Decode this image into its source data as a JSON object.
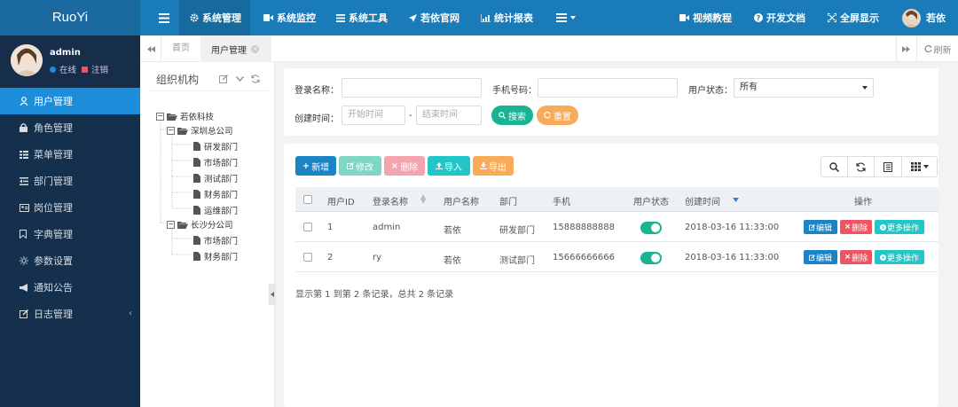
{
  "app": {
    "brand": "RuoYi"
  },
  "topnav": {
    "items": [
      {
        "label": "系统管理",
        "icon": "gear-icon"
      },
      {
        "label": "系统监控",
        "icon": "video-icon"
      },
      {
        "label": "系统工具",
        "icon": "list-icon"
      },
      {
        "label": "若依官网",
        "icon": "send-icon"
      },
      {
        "label": "统计报表",
        "icon": "chart-icon"
      }
    ],
    "right": [
      {
        "label": "视频教程",
        "icon": "video-icon"
      },
      {
        "label": "开发文档",
        "icon": "question-icon"
      },
      {
        "label": "全屏显示",
        "icon": "fullscreen-icon"
      }
    ],
    "user": "若依"
  },
  "profile": {
    "name": "admin",
    "online": "在线",
    "logout": "注销"
  },
  "sidebar": {
    "items": [
      {
        "label": "用户管理",
        "active": true
      },
      {
        "label": "角色管理"
      },
      {
        "label": "菜单管理"
      },
      {
        "label": "部门管理"
      },
      {
        "label": "岗位管理"
      },
      {
        "label": "字典管理"
      },
      {
        "label": "参数设置"
      },
      {
        "label": "通知公告"
      },
      {
        "label": "日志管理"
      }
    ]
  },
  "tabs": {
    "home": "首页",
    "current": "用户管理",
    "refresh": "刷新"
  },
  "org": {
    "title": "组织机构",
    "tree": [
      {
        "label": "若依科技",
        "level": 0,
        "type": "folder"
      },
      {
        "label": "深圳总公司",
        "level": 1,
        "type": "folder"
      },
      {
        "label": "研发部门",
        "level": 2,
        "type": "file"
      },
      {
        "label": "市场部门",
        "level": 2,
        "type": "file"
      },
      {
        "label": "测试部门",
        "level": 2,
        "type": "file"
      },
      {
        "label": "财务部门",
        "level": 2,
        "type": "file"
      },
      {
        "label": "运维部门",
        "level": 2,
        "type": "file"
      },
      {
        "label": "长沙分公司",
        "level": 1,
        "type": "folder"
      },
      {
        "label": "市场部门",
        "level": 2,
        "type": "file"
      },
      {
        "label": "财务部门",
        "level": 2,
        "type": "file"
      }
    ]
  },
  "search": {
    "login_label": "登录名称：",
    "phone_label": "手机号码：",
    "status_label": "用户状态：",
    "status_value": "所有",
    "created_label": "创建时间：",
    "start_placeholder": "开始时间",
    "end_placeholder": "结束时间",
    "dash": "-",
    "search_btn": "搜索",
    "reset_btn": "重置"
  },
  "toolbar": {
    "add": "新增",
    "edit": "修改",
    "delete": "删除",
    "import": "导入",
    "export": "导出"
  },
  "table": {
    "headers": [
      "用户ID",
      "登录名称",
      "用户名称",
      "部门",
      "手机",
      "用户状态",
      "创建时间",
      "操作"
    ],
    "rows": [
      {
        "id": "1",
        "login": "admin",
        "name": "若依",
        "dept": "研发部门",
        "phone": "15888888888",
        "status": true,
        "created": "2018-03-16 11:33:00"
      },
      {
        "id": "2",
        "login": "ry",
        "name": "若依",
        "dept": "测试部门",
        "phone": "15666666666",
        "status": true,
        "created": "2018-03-16 11:33:00"
      }
    ],
    "actions": {
      "edit": "编辑",
      "delete": "删除",
      "more": "更多操作"
    },
    "footer": "显示第 1 到第 2 条记录，总共 2 条记录"
  },
  "colors": {
    "primary": "#1a7bb9",
    "sidebar": "#15304d",
    "active": "#1c8ddb",
    "success": "#1ab394",
    "danger": "#ed5565",
    "warning": "#f8ac59",
    "info": "#23c6c8"
  }
}
